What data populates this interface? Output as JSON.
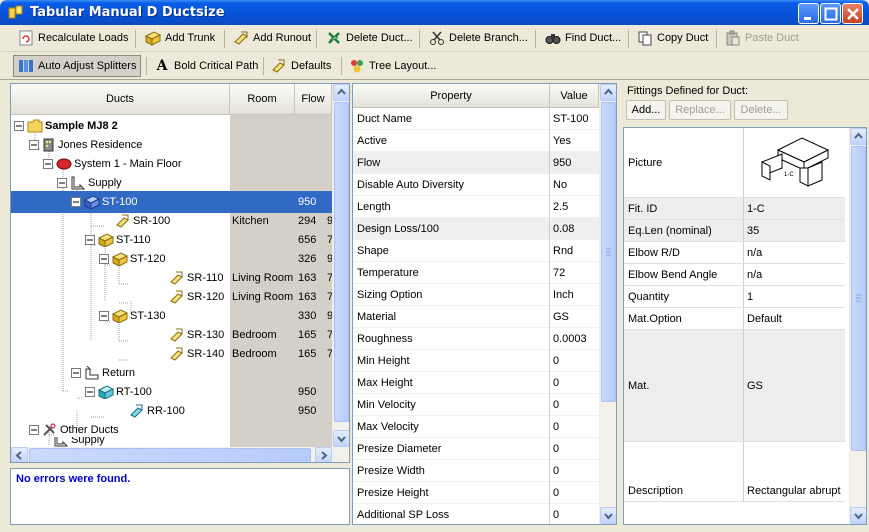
{
  "window": {
    "title": "Tabular Manual D Ductsize"
  },
  "toolbar1": [
    {
      "label": "Recalculate Loads",
      "icon": "recalculate-icon",
      "enabled": true
    },
    {
      "label": "Add Trunk",
      "icon": "add-trunk-icon",
      "enabled": true
    },
    {
      "label": "Add Runout",
      "icon": "add-runout-icon",
      "enabled": true
    },
    {
      "label": "Delete Duct...",
      "icon": "delete-duct-icon",
      "enabled": true
    },
    {
      "label": "Delete Branch...",
      "icon": "delete-branch-icon",
      "enabled": true
    },
    {
      "label": "Find Duct...",
      "icon": "find-duct-icon",
      "enabled": true
    },
    {
      "label": "Copy Duct",
      "icon": "copy-duct-icon",
      "enabled": true
    },
    {
      "label": "Paste Duct",
      "icon": "paste-duct-icon",
      "enabled": false
    }
  ],
  "toolbar2": [
    {
      "label": "Auto Adjust Splitters",
      "icon": "auto-adjust-splitters-icon",
      "pressed": true
    },
    {
      "label": "Bold Critical Path",
      "icon": "bold-icon",
      "pressed": false
    },
    {
      "label": "Defaults",
      "icon": "defaults-icon",
      "pressed": false
    },
    {
      "label": "Tree Layout...",
      "icon": "tree-layout-icon",
      "pressed": false
    }
  ],
  "tree": {
    "columns": [
      "Ducts",
      "Room",
      "Flow"
    ],
    "rows": [
      {
        "label": "Sample MJ8 2",
        "room": "",
        "flow": "",
        "extra": "",
        "bold": true,
        "icon": "folder"
      },
      {
        "label": "Jones Residence",
        "room": "",
        "flow": "",
        "extra": "",
        "icon": "building"
      },
      {
        "label": "System 1 - Main Floor",
        "room": "",
        "flow": "",
        "extra": "",
        "icon": "system"
      },
      {
        "label": "Supply",
        "room": "",
        "flow": "",
        "extra": "",
        "icon": "supply"
      },
      {
        "label": "ST-100",
        "room": "",
        "flow": "950",
        "extra": "",
        "icon": "trunk",
        "selected": true
      },
      {
        "label": "SR-100",
        "room": "Kitchen",
        "flow": "294",
        "extra": "9",
        "icon": "runout"
      },
      {
        "label": "ST-110",
        "room": "",
        "flow": "656",
        "extra": "7",
        "icon": "trunk"
      },
      {
        "label": "ST-120",
        "room": "",
        "flow": "326",
        "extra": "9",
        "icon": "trunk"
      },
      {
        "label": "SR-110",
        "room": "Living Room",
        "flow": "163",
        "extra": "7",
        "icon": "runout"
      },
      {
        "label": "SR-120",
        "room": "Living Room",
        "flow": "163",
        "extra": "7",
        "icon": "runout"
      },
      {
        "label": "ST-130",
        "room": "",
        "flow": "330",
        "extra": "9",
        "icon": "trunk"
      },
      {
        "label": "SR-130",
        "room": "Bedroom",
        "flow": "165",
        "extra": "7",
        "icon": "runout"
      },
      {
        "label": "SR-140",
        "room": "Bedroom",
        "flow": "165",
        "extra": "7",
        "icon": "runout"
      },
      {
        "label": "Return",
        "room": "",
        "flow": "",
        "extra": "",
        "icon": "return"
      },
      {
        "label": "RT-100",
        "room": "",
        "flow": "950",
        "extra": "",
        "icon": "return-trunk"
      },
      {
        "label": "RR-100",
        "room": "",
        "flow": "950",
        "extra": "",
        "icon": "return-runout"
      },
      {
        "label": "Other Ducts",
        "room": "",
        "flow": "",
        "extra": "",
        "icon": "tools"
      },
      {
        "label": "Supply",
        "room": "",
        "flow": "",
        "extra": "",
        "icon": "supply"
      }
    ]
  },
  "status": {
    "message": "No errors were found."
  },
  "properties": {
    "columns": [
      "Property",
      "Value"
    ],
    "rows": [
      {
        "key": "Duct Name",
        "value": "ST-100"
      },
      {
        "key": "Active",
        "value": "Yes"
      },
      {
        "key": "Flow",
        "value": "950"
      },
      {
        "key": "Disable Auto Diversity",
        "value": "No"
      },
      {
        "key": "Length",
        "value": "2.5"
      },
      {
        "key": "Design Loss/100",
        "value": "0.08"
      },
      {
        "key": "Shape",
        "value": "Rnd"
      },
      {
        "key": "Temperature",
        "value": "72"
      },
      {
        "key": "Sizing Option",
        "value": "Inch"
      },
      {
        "key": "Material",
        "value": "GS"
      },
      {
        "key": "Roughness",
        "value": "0.0003"
      },
      {
        "key": "Min Height",
        "value": "0"
      },
      {
        "key": "Max Height",
        "value": "0"
      },
      {
        "key": "Min Velocity",
        "value": "0"
      },
      {
        "key": "Max Velocity",
        "value": "0"
      },
      {
        "key": "Presize Diameter",
        "value": "0"
      },
      {
        "key": "Presize Width",
        "value": "0"
      },
      {
        "key": "Presize Height",
        "value": "0"
      },
      {
        "key": "Additional SP Loss",
        "value": "0"
      }
    ]
  },
  "fittings": {
    "title": "Fittings Defined for Duct:",
    "buttons": [
      {
        "label": "Add...",
        "enabled": true
      },
      {
        "label": "Replace...",
        "enabled": false
      },
      {
        "label": "Delete...",
        "enabled": false
      }
    ],
    "picture_caption": "1-C",
    "rows": [
      {
        "key": "Picture",
        "value": ""
      },
      {
        "key": "Fit. ID",
        "value": "1-C"
      },
      {
        "key": "Eq.Len (nominal)",
        "value": "35"
      },
      {
        "key": "Elbow R/D",
        "value": "n/a"
      },
      {
        "key": "Elbow Bend Angle",
        "value": "n/a"
      },
      {
        "key": "Quantity",
        "value": "1"
      },
      {
        "key": "Mat.Option",
        "value": "Default"
      },
      {
        "key": "Mat.",
        "value": "GS"
      },
      {
        "key": "Description",
        "value": "Rectangular abrupt"
      }
    ]
  }
}
